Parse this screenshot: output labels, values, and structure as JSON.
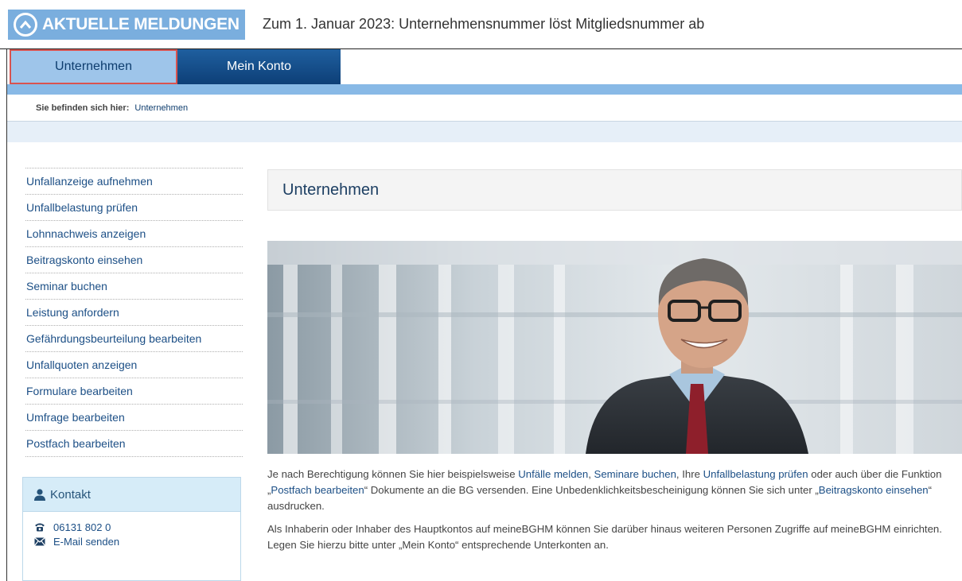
{
  "news": {
    "badge_label": "AKTUELLE MELDUNGEN",
    "headline": "Zum 1. Januar 2023: Unternehmensnummer löst Mitgliedsnummer ab"
  },
  "nav": {
    "tabs": [
      {
        "label": "Unternehmen",
        "active": true
      },
      {
        "label": "Mein Konto",
        "active": false
      }
    ]
  },
  "breadcrumb": {
    "prefix": "Sie befinden sich hier:",
    "current": "Unternehmen"
  },
  "sidebar": {
    "items": [
      {
        "label": "Unfallanzeige aufnehmen"
      },
      {
        "label": "Unfallbelastung prüfen"
      },
      {
        "label": "Lohnnachweis anzeigen"
      },
      {
        "label": "Beitragskonto einsehen"
      },
      {
        "label": "Seminar buchen"
      },
      {
        "label": "Leistung anfordern"
      },
      {
        "label": "Gefährdungsbeurteilung bearbeiten"
      },
      {
        "label": "Unfallquoten anzeigen"
      },
      {
        "label": "Formulare bearbeiten"
      },
      {
        "label": "Umfrage bearbeiten"
      },
      {
        "label": "Postfach bearbeiten"
      }
    ]
  },
  "contact": {
    "title": "Kontakt",
    "phone": "06131 802 0",
    "email_label": "E-Mail senden",
    "icons": {
      "header": "user-icon",
      "phone": "phone-icon",
      "email": "envelope-icon"
    }
  },
  "main": {
    "heading": "Unternehmen",
    "paragraph1": {
      "t1": "Je nach Berechtigung können Sie hier beispielsweise ",
      "l1": "Unfälle melden",
      "t2": ", ",
      "l2": "Seminare buchen",
      "t3": ", Ihre ",
      "l3": "Unfallbelastung prüfen",
      "t4": " oder auch über die Funktion „",
      "l4": "Postfach bearbeiten",
      "t5": "“ Dokumente an die BG versenden. Eine Unbedenklichkeitsbescheinigung können Sie sich unter „",
      "l5": "Beitragskonto einsehen",
      "t6": "“ ausdrucken."
    },
    "paragraph2": "Als Inhaberin oder Inhaber des Hauptkontos auf meineBGHM können Sie darüber hinaus weiteren Personen Zugriffe auf meineBGHM einrichten. Legen Sie hierzu bitte unter „Mein Konto“ entsprechende Unterkonten an."
  },
  "colors": {
    "accent_blue": "#7aaede",
    "nav_dark": "#0d3f77",
    "link": "#1c4f86",
    "highlight_border": "#d9534f"
  }
}
